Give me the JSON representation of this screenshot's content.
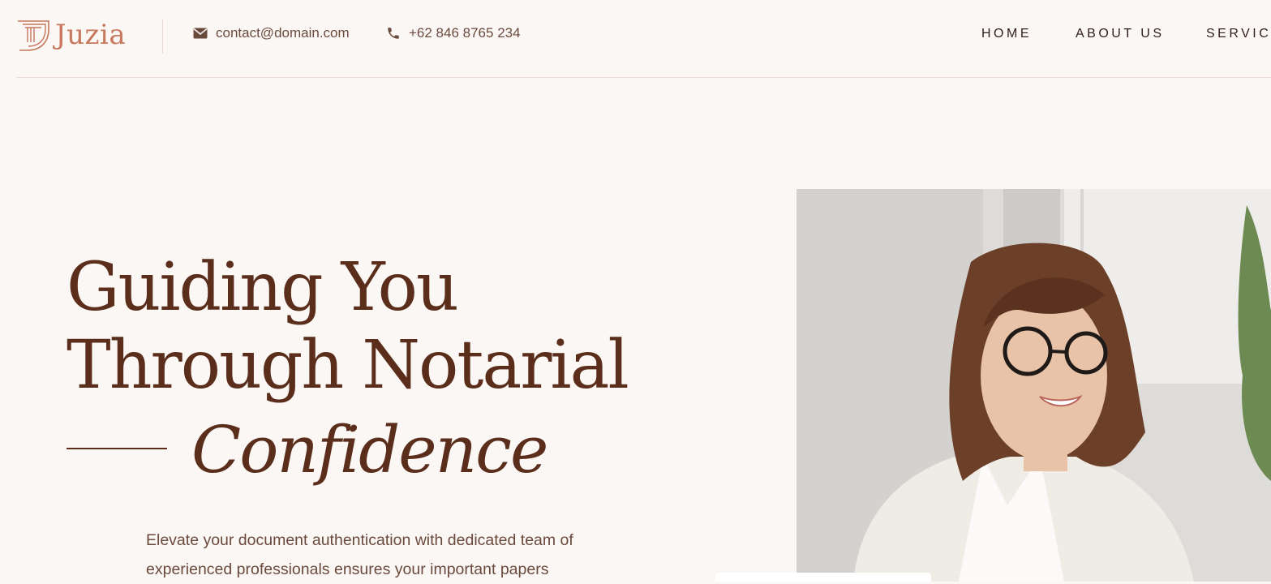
{
  "brand": {
    "name": "Juzia"
  },
  "header": {
    "email": "contact@domain.com",
    "phone": "+62 846 8765 234",
    "icons": {
      "email": "envelope-icon",
      "phone": "phone-icon"
    }
  },
  "nav": {
    "items": [
      "HOME",
      "ABOUT US",
      "SERVICE"
    ]
  },
  "hero": {
    "title_line1": "Guiding You",
    "title_line2": "Through Notarial",
    "title_line3": "Confidence",
    "description": "Elevate your document authentication with dedicated team of experienced professionals ensures your important papers"
  },
  "colors": {
    "background": "#fbf7f4",
    "accent": "#c7785d",
    "heading": "#5b2e1c",
    "body_text": "#6b4a3e"
  }
}
